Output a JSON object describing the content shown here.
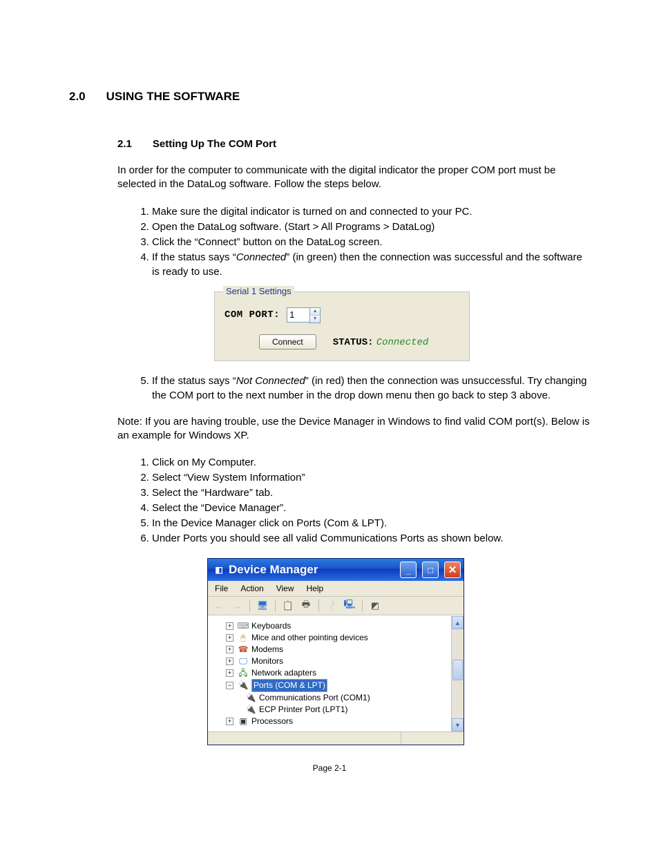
{
  "section": {
    "num": "2.0",
    "title": "USING THE SOFTWARE"
  },
  "subsection": {
    "num": "2.1",
    "title": "Setting Up The COM Port"
  },
  "intro": "In order for the computer to communicate with the digital indicator the proper COM port must be selected in the DataLog software. Follow the steps below.",
  "stepsA": {
    "s1": "Make sure the digital indicator is turned on and connected to your PC.",
    "s2": "Open the DataLog software. (Start > All Programs > DataLog)",
    "s3": "Click the “Connect” button on the DataLog screen.",
    "s4_a": "If the status says “",
    "s4_b": "Connected",
    "s4_c": "” (in green) then the connection was successful and the software is ready to use.",
    "s5_a": "If the status says “",
    "s5_b": "Not Connected",
    "s5_c": "” (in red) then the connection was unsuccessful. Try changing the COM port to the next number in the drop down menu then go back to step 3 above."
  },
  "serial": {
    "legend": "Serial 1 Settings",
    "comport_label": "COM PORT:",
    "comport_value": "1",
    "connect_btn": "Connect",
    "status_label": "STATUS:",
    "status_value": "Connected"
  },
  "note": "Note: If you are having trouble, use the Device Manager in Windows to find valid COM port(s). Below is an example for Windows XP.",
  "stepsB": {
    "s1": "Click on My Computer.",
    "s2": "Select “View System Information”",
    "s3": "Select the “Hardware” tab.",
    "s4": "Select the “Device Manager”.",
    "s5": "In the Device Manager click on Ports (Com & LPT).",
    "s6": "Under Ports you should see all valid Communications Ports as shown below."
  },
  "dm": {
    "title": "Device Manager",
    "menus": {
      "file": "File",
      "action": "Action",
      "view": "View",
      "help": "Help"
    },
    "tree": {
      "keyboards": "Keyboards",
      "mice": "Mice and other pointing devices",
      "modems": "Modems",
      "monitors": "Monitors",
      "net": "Network adapters",
      "ports": "Ports (COM & LPT)",
      "com1": "Communications Port (COM1)",
      "lpt1": "ECP Printer Port (LPT1)",
      "proc": "Processors"
    }
  },
  "footer": "Page 2-1"
}
